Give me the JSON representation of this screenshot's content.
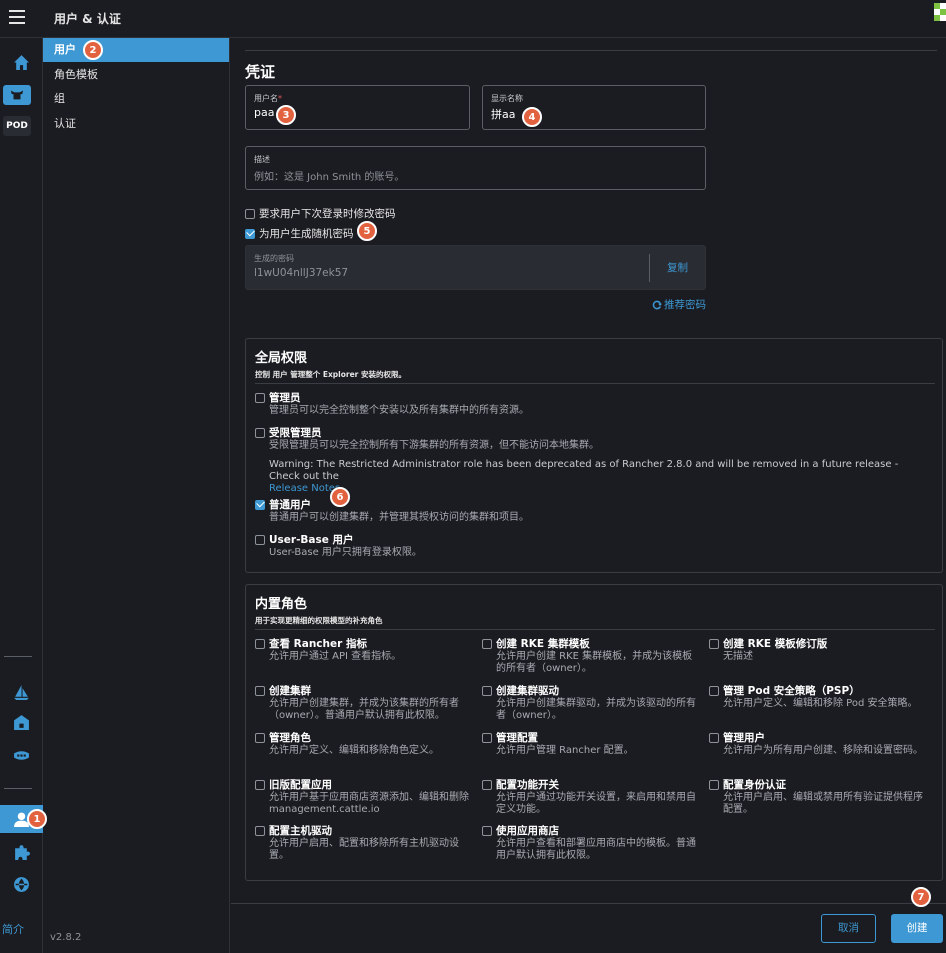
{
  "app": {
    "title": "用户 & 认证",
    "version": "v2.8.2",
    "intro_label": "简介",
    "pod_label": "POD"
  },
  "nav": {
    "items": [
      {
        "label": "用户"
      },
      {
        "label": "角色模板"
      },
      {
        "label": "组"
      },
      {
        "label": "认证"
      }
    ]
  },
  "credentials": {
    "heading": "凭证",
    "username_label": "用户名",
    "username_required": "*",
    "username_value": "paa",
    "display_name_label": "显示名称",
    "display_name_value": "拼aa",
    "description_label": "描述",
    "description_placeholder": "例如：这是 John Smith 的账号。",
    "require_change_label": "要求用户下次登录时修改密码",
    "require_change_checked": false,
    "generate_random_label": "为用户生成随机密码",
    "generate_random_checked": true,
    "generated_label": "生成的密码",
    "generated_value": "l1wU04nllJ37ek57",
    "copy_label": "复制",
    "suggest_label": "推荐密码"
  },
  "global": {
    "title": "全局权限",
    "subtitle": "控制 用户 管理整个 Explorer 安装的权限。",
    "options": [
      {
        "label": "管理员",
        "desc": "管理员可以完全控制整个安装以及所有集群中的所有资源。",
        "checked": false
      },
      {
        "label": "受限管理员",
        "desc": "受限管理员可以完全控制所有下游集群的所有资源，但不能访问本地集群。",
        "checked": false
      },
      {
        "label": "普通用户",
        "desc": "普通用户可以创建集群，并管理其授权访问的集群和项目。",
        "checked": true
      },
      {
        "label": "User-Base 用户",
        "desc": "User-Base 用户只拥有登录权限。",
        "checked": false
      }
    ],
    "warning": "Warning: The Restricted Administrator role has been deprecated as of Rancher 2.8.0 and will be removed in a future release - Check out the",
    "warning_link": "Release Notes"
  },
  "builtin": {
    "title": "内置角色",
    "subtitle": "用于实现更精细的权限模型的补充角色",
    "roles": [
      {
        "label": "查看 Rancher 指标",
        "desc": "允许用户通过 API 查看指标。"
      },
      {
        "label": "创建 RKE 集群模板",
        "desc": "允许用户创建 RKE 集群模板，并成为该模板的所有者（owner）。"
      },
      {
        "label": "创建 RKE 模板修订版",
        "desc": "无描述"
      },
      {
        "label": "创建集群",
        "desc": "允许用户创建集群，并成为该集群的所有者（owner）。普通用户默认拥有此权限。"
      },
      {
        "label": "创建集群驱动",
        "desc": "允许用户创建集群驱动，并成为该驱动的所有者（owner）。"
      },
      {
        "label": "管理 Pod 安全策略（PSP）",
        "desc": "允许用户定义、编辑和移除 Pod 安全策略。"
      },
      {
        "label": "管理角色",
        "desc": "允许用户定义、编辑和移除角色定义。"
      },
      {
        "label": "管理配置",
        "desc": "允许用户管理 Rancher 配置。"
      },
      {
        "label": "管理用户",
        "desc": "允许用户为所有用户创建、移除和设置密码。"
      },
      {
        "label": "旧版配置应用",
        "desc": "允许用户基于应用商店资源添加、编辑和删除management.cattle.io"
      },
      {
        "label": "配置功能开关",
        "desc": "允许用户通过功能开关设置，来启用和禁用自定义功能。"
      },
      {
        "label": "配置身份认证",
        "desc": "允许用户启用、编辑或禁用所有验证提供程序配置。"
      },
      {
        "label": "配置主机驱动",
        "desc": "允许用户启用、配置和移除所有主机驱动设置。"
      },
      {
        "label": "使用应用商店",
        "desc": "允许用户查看和部署应用商店中的模板。普通用户默认拥有此权限。"
      }
    ]
  },
  "footer": {
    "cancel_label": "取消",
    "create_label": "创建"
  },
  "badges": [
    "1",
    "2",
    "3",
    "4",
    "5",
    "6",
    "7"
  ],
  "colors": {
    "accent": "#3d98d3",
    "badge": "#e2613f",
    "background": "#1b1c21"
  }
}
